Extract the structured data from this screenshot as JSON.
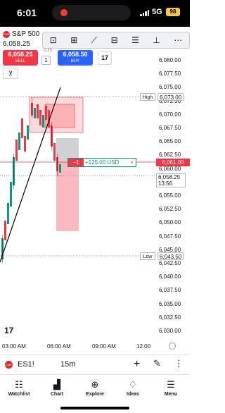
{
  "status": {
    "time": "6:01",
    "network": "5G",
    "battery": "98"
  },
  "chart": {
    "symbol": "S&P 500",
    "last_price": "6,058.25",
    "sell_price": "6,058.25",
    "sell_label": "SELL",
    "buy_price": "6,058.50",
    "buy_label": "BUY",
    "spread": "0.25",
    "quantity": "1",
    "tv_badge": "TV",
    "toolbar_icons": [
      "magnet-icon",
      "group-icon",
      "trendline-icon",
      "grid-icon",
      "settings-icon",
      "text-icon",
      "more-icon"
    ],
    "price_ticks": [
      "6,080.00",
      "6,077.50",
      "6,075.00",
      "6,072.50",
      "6,070.00",
      "6,067.50",
      "6,065.00",
      "6,062.50",
      "6,060.00",
      "6,057.50",
      "6,055.00",
      "6,052.50",
      "6,050.00",
      "6,047.50",
      "6,045.00",
      "6,042.50",
      "6,040.00",
      "6,037.50",
      "6,035.00",
      "6,032.50",
      "6,030.00"
    ],
    "high_label": "High",
    "high_price": "6,073.00",
    "low_label": "Low",
    "low_price": "6,043.50",
    "position_price": "6,061.00",
    "current_price": "6,058.25",
    "countdown": "13:56",
    "position": {
      "qty": "−1",
      "pnl": "+125.00 USD",
      "close": "×"
    },
    "time_ticks": [
      "03:00 AM",
      "06:00 AM",
      "09:00 AM",
      "12:00"
    ],
    "colors": {
      "up": "#089981",
      "down": "#f23645",
      "sell": "#f23645",
      "buy": "#2962ff"
    }
  },
  "symbol_bar": {
    "symbol": "ES1!",
    "interval": "15m"
  },
  "nav": [
    {
      "label": "Watchlist",
      "icon": "watchlist-icon"
    },
    {
      "label": "Chart",
      "icon": "chart-icon"
    },
    {
      "label": "Explore",
      "icon": "explore-icon"
    },
    {
      "label": "Ideas",
      "icon": "ideas-icon"
    },
    {
      "label": "Menu",
      "icon": "menu-icon"
    }
  ]
}
